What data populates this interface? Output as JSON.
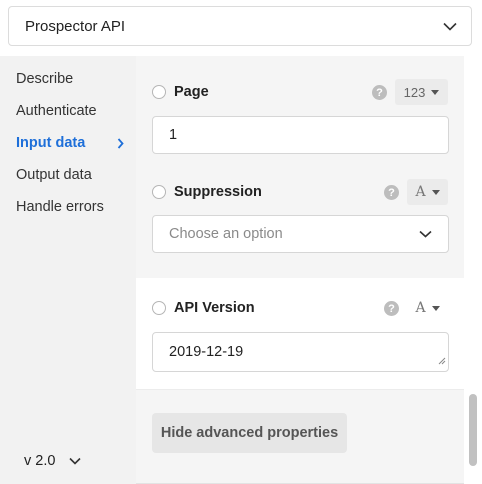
{
  "header": {
    "select_value": "Prospector API",
    "icon": "chevron-down-icon"
  },
  "sidebar": {
    "items": [
      {
        "label": "Describe",
        "active": false
      },
      {
        "label": "Authenticate",
        "active": false
      },
      {
        "label": "Input data",
        "active": true
      },
      {
        "label": "Output data",
        "active": false
      },
      {
        "label": "Handle errors",
        "active": false
      }
    ],
    "version": "v 2.0",
    "accent_color": "#1e6fd9"
  },
  "fields": {
    "page": {
      "label": "Page",
      "type_label": "123",
      "value": "1"
    },
    "suppression": {
      "label": "Suppression",
      "type_label": "A",
      "placeholder": "Choose an option"
    },
    "api_version": {
      "label": "API Version",
      "type_label": "A",
      "value": "2019-12-19"
    }
  },
  "help_glyph": "?",
  "actions": {
    "hide_advanced_label": "Hide advanced properties"
  }
}
